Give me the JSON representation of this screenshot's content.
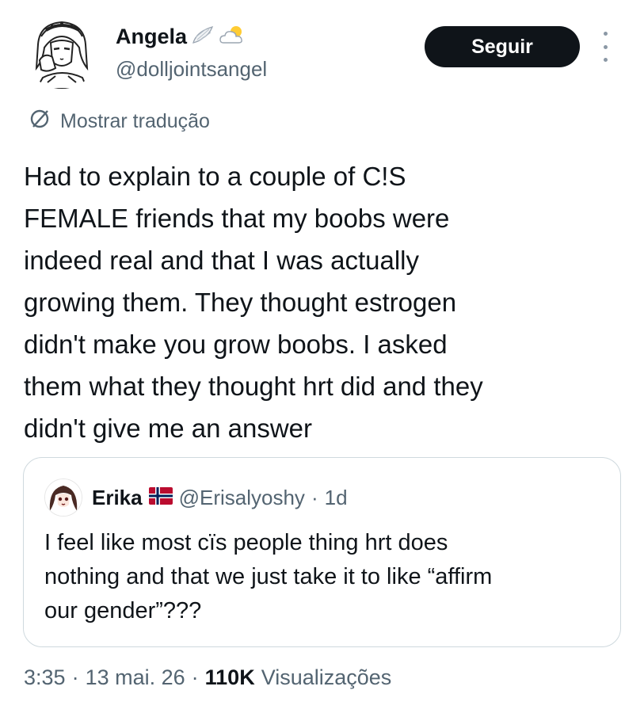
{
  "author": {
    "display_name": "Angela",
    "handle": "@dolljointsangel",
    "badges": [
      "wing-emoji-icon",
      "sun-behind-cloud-emoji-icon"
    ]
  },
  "follow_label": "Seguir",
  "translate_label": "Mostrar tradução",
  "tweet_lines": [
    "Had to explain to a couple of C!S",
    "FEMALE friends that my boobs were",
    "indeed real and that I was actually",
    "growing them. They thought estrogen",
    "didn't make you grow boobs. I asked",
    "them what they thought hrt did and they",
    "didn't give me an answer"
  ],
  "quoted": {
    "display_name": "Erika",
    "flag": "norway-flag-icon",
    "handle": "@Erisalyoshy",
    "separator": "·",
    "age": "1d",
    "text_lines": [
      "I feel like most cïs people thing hrt does",
      "nothing and that we just take it to like “affirm",
      "our gender”???"
    ]
  },
  "meta": {
    "time": "3:35",
    "date": "13 mai. 26",
    "views_count": "110K",
    "views_label": "Visualizações",
    "separator": "·"
  },
  "colors": {
    "text": "#0f1419",
    "secondary": "#536471",
    "border": "#cfd9de",
    "button_bg": "#0f1419"
  }
}
